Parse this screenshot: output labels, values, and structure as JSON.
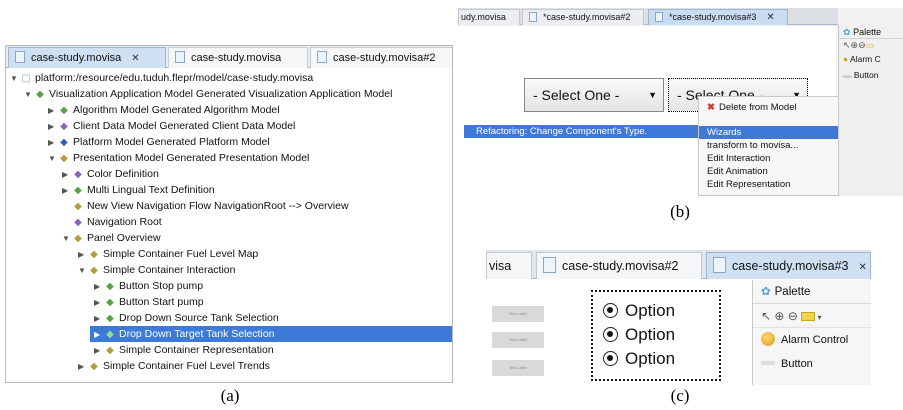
{
  "panel_a": {
    "tabs": [
      {
        "label": "case-study.movisa",
        "close": "✕"
      },
      {
        "label": "case-study.movisa"
      },
      {
        "label": "case-study.movisa#2"
      }
    ],
    "tree": [
      {
        "label": "platform:/resource/edu.tuduh.flepr/model/case-study.movisa"
      },
      {
        "label": "Visualization Application Model Generated Visualization Application Model"
      },
      {
        "label": "Algorithm Model Generated Algorithm Model"
      },
      {
        "label": "Client Data Model Generated Client Data Model"
      },
      {
        "label": "Platform Model Generated Platform Model"
      },
      {
        "label": "Presentation Model Generated Presentation Model"
      },
      {
        "label": "Color Definition"
      },
      {
        "label": "Multi Lingual Text Definition"
      },
      {
        "label": "New View Navigation Flow NavigationRoot --> Overview"
      },
      {
        "label": "Navigation Root"
      },
      {
        "label": "Panel Overview"
      },
      {
        "label": "Simple Container Fuel Level Map"
      },
      {
        "label": "Simple Container Interaction"
      },
      {
        "label": "Button Stop pump"
      },
      {
        "label": "Button Start pump"
      },
      {
        "label": "Drop Down Source Tank Selection"
      },
      {
        "label": "Drop Down Target Tank Selection"
      },
      {
        "label": "Simple Container Representation"
      },
      {
        "label": "Simple Container Fuel Level Trends"
      }
    ],
    "caption": "(a)"
  },
  "panel_b": {
    "tabs": [
      {
        "label": "udy.movisa"
      },
      {
        "label": "*case-study.movisa#2"
      },
      {
        "label": "*case-study.movisa#3",
        "close": "✕"
      }
    ],
    "select1": "- Select One -",
    "select2": "- Select One -",
    "refactor": "Refactoring: Change Component's Type.",
    "menu": [
      "Delete from Model",
      "Wizards",
      "transform to movisa...",
      "Edit Interaction",
      "Edit Animation",
      "Edit Representation"
    ],
    "palette_title": "Palette",
    "palette_items": [
      "Alarm C",
      "Button"
    ],
    "caption": "(b)"
  },
  "panel_c": {
    "tabs": [
      {
        "label": "visa"
      },
      {
        "label": "case-study.movisa#2"
      },
      {
        "label": "case-study.movisa#3",
        "close": "✕"
      }
    ],
    "text_labels": [
      "Text Label",
      "Text Label",
      "Text Label"
    ],
    "options": [
      "Option",
      "Option",
      "Option"
    ],
    "palette_title": "Palette",
    "palette_items": [
      "Alarm Control",
      "Button"
    ],
    "caption": "(c)"
  }
}
